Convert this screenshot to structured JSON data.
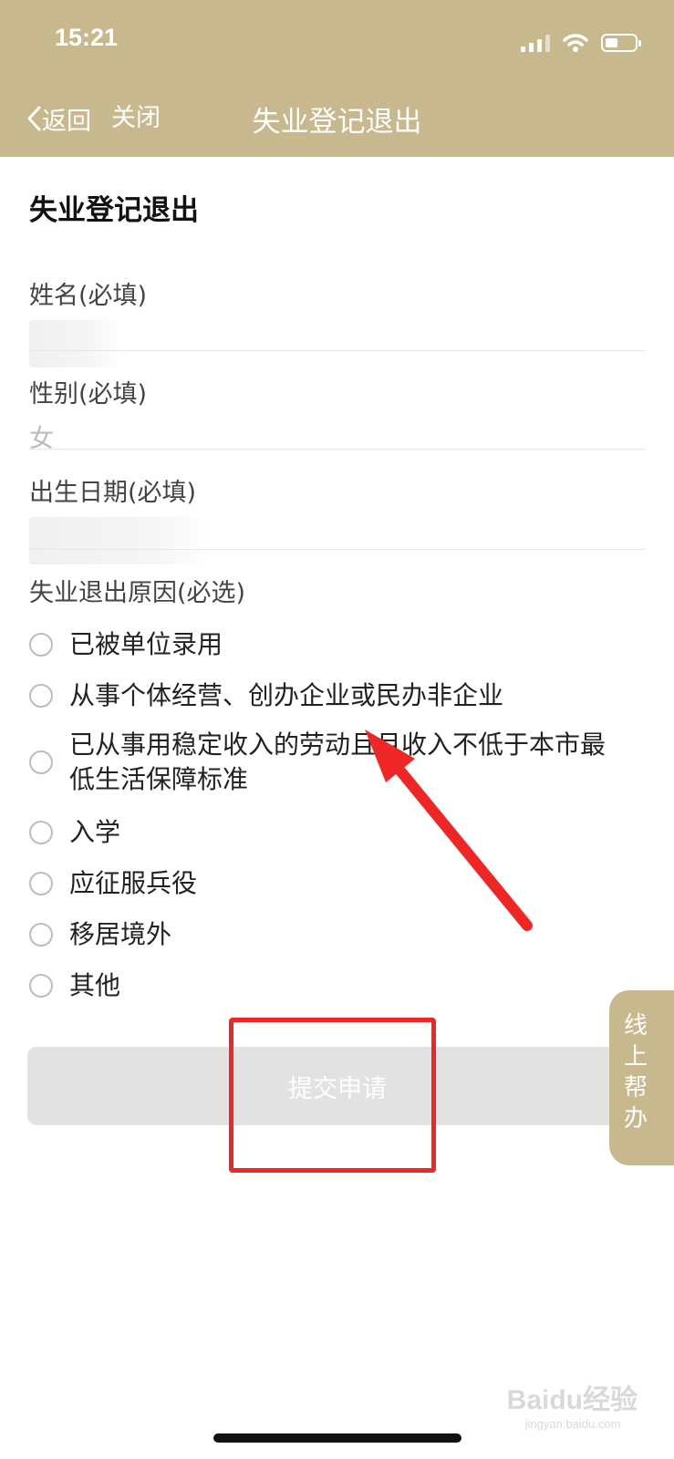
{
  "status_bar": {
    "time": "15:21"
  },
  "nav": {
    "back_label": "返回",
    "close_label": "关闭",
    "title": "失业登记退出"
  },
  "page": {
    "heading": "失业登记退出"
  },
  "form": {
    "name": {
      "label": "姓名(必填)",
      "value": ""
    },
    "gender": {
      "label": "性别(必填)",
      "value": "女"
    },
    "birth": {
      "label": "出生日期(必填)",
      "value": ""
    },
    "reason": {
      "label": "失业退出原因(必选)",
      "options": [
        "已被单位录用",
        "从事个体经营、创办企业或民办非企业",
        "已从事用稳定收入的劳动且月收入不低于本市最低生活保障标准",
        "入学",
        "应征服兵役",
        "移居境外",
        "其他"
      ]
    }
  },
  "submit_label": "提交申请",
  "helper_label": "线上帮办",
  "watermark": {
    "brand": "Baidu经验",
    "url": "jingyan.baidu.com"
  },
  "colors": {
    "brand": "#c8b88e",
    "annotation": "#ee2626",
    "button_disabled": "#e2e2e2"
  }
}
